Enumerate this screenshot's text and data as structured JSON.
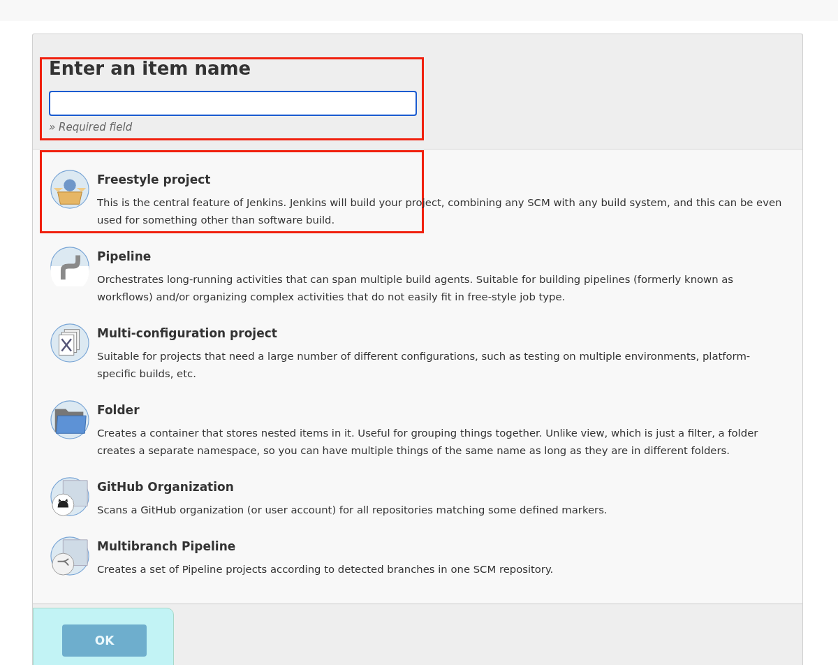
{
  "header": {
    "title": "Enter an item name",
    "name_field": {
      "focused": true
    },
    "hint": "» Required field",
    "highlighted": true
  },
  "item_types": [
    {
      "kind": "freestyle",
      "title": "Freestyle project",
      "description": "This is the central feature of Jenkins. Jenkins will build your project, combining any SCM with any build system, and this can be even used for something other than software build.",
      "highlighted": true
    },
    {
      "kind": "pipeline",
      "title": "Pipeline",
      "description": "Orchestrates long-running activities that can span multiple build agents. Suitable for building pipelines (formerly known as workflows) and/or organizing complex activities that do not easily fit in free-style job type.",
      "highlighted": false
    },
    {
      "kind": "multiconfig",
      "title": "Multi-configuration project",
      "description": "Suitable for projects that need a large number of different configurations, such as testing on multiple environments, platform-specific builds, etc.",
      "highlighted": false
    },
    {
      "kind": "folder",
      "title": "Folder",
      "description": "Creates a container that stores nested items in it. Useful for grouping things together. Unlike view, which is just a filter, a folder creates a separate namespace, so you can have multiple things of the same name as long as they are in different folders.",
      "highlighted": false
    },
    {
      "kind": "github",
      "title": "GitHub Organization",
      "description": "Scans a GitHub organization (or user account) for all repositories matching some defined markers.",
      "highlighted": false
    },
    {
      "kind": "multibranch",
      "title": "Multibranch Pipeline",
      "description": "Creates a set of Pipeline projects according to detected branches in one SCM repository.",
      "highlighted": false
    }
  ],
  "footer": {
    "ok_button": "OK"
  }
}
